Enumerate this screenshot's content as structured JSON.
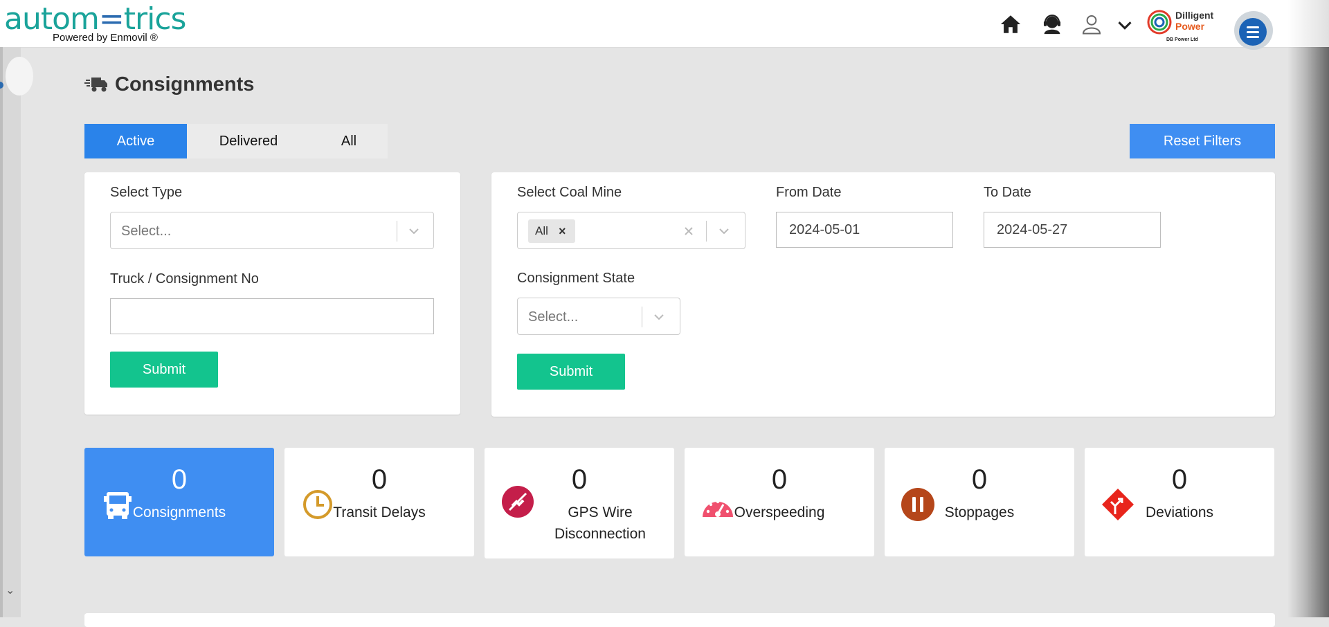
{
  "header": {
    "logo_text_left": "autom",
    "logo_text_mid": "=",
    "logo_text_right": "trics",
    "logo_sub": "Powered by Enmovil ®",
    "brand_line1": "Dilligent",
    "brand_line2": "Power",
    "brand_sub": "DB Power Ltd",
    "icons": [
      "home-icon",
      "support-agent-icon",
      "user-icon",
      "chevron-down-icon",
      "menu-icon"
    ]
  },
  "page": {
    "title": "Consignments"
  },
  "tabs": [
    {
      "label": "Active",
      "active": true
    },
    {
      "label": "Delivered",
      "active": false
    },
    {
      "label": "All",
      "active": false
    }
  ],
  "reset_label": "Reset Filters",
  "filter_left": {
    "select_type_label": "Select Type",
    "select_type_placeholder": "Select...",
    "truck_label": "Truck / Consignment No",
    "truck_value": "",
    "submit_label": "Submit"
  },
  "filter_right": {
    "coal_mine_label": "Select Coal Mine",
    "coal_mine_chip": "All",
    "coal_mine_chip_remove": "×",
    "from_date_label": "From Date",
    "from_date_value": "2024-05-01",
    "to_date_label": "To Date",
    "to_date_value": "2024-05-27",
    "state_label": "Consignment State",
    "state_placeholder": "Select...",
    "submit_label": "Submit"
  },
  "stats": [
    {
      "count": "0",
      "label": "Consignments",
      "icon": "truck-icon",
      "color": "#3f8ef2"
    },
    {
      "count": "0",
      "label": "Transit Delays",
      "icon": "clock-icon",
      "color": "#d49a2a"
    },
    {
      "count": "0",
      "label": "GPS Wire Disconnection",
      "icon": "unplug-icon",
      "color": "#c41e4a"
    },
    {
      "count": "0",
      "label": "Overspeeding",
      "icon": "speedometer-icon",
      "color": "#f0506e"
    },
    {
      "count": "0",
      "label": "Stoppages",
      "icon": "pause-icon",
      "color": "#b5461a"
    },
    {
      "count": "0",
      "label": "Deviations",
      "icon": "route-deviation-icon",
      "color": "#e8251c"
    }
  ]
}
